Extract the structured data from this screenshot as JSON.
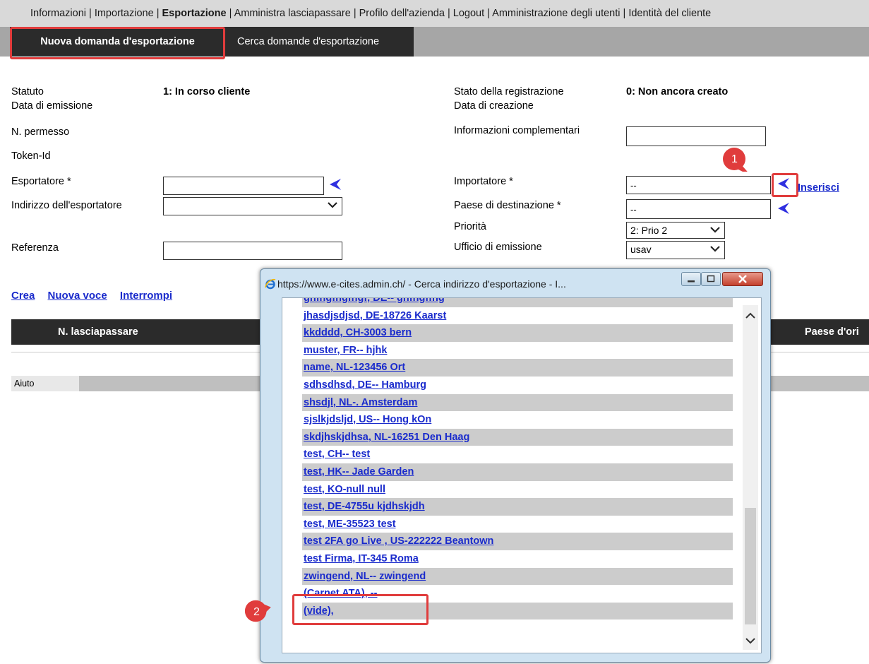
{
  "topnav": {
    "items": [
      "Informazioni",
      "Importazione",
      "Esportazione",
      "Amministra lasciapassare",
      "Profilo dell'azienda",
      "Logout",
      "Amministrazione degli utenti",
      "Identità del cliente"
    ],
    "separator": "|"
  },
  "subnav": {
    "tab_new": "Nuova domanda d'esportazione",
    "tab_search": "Cerca domande d'esportazione"
  },
  "form": {
    "statuto_label": "Statuto",
    "statuto_value": "1: In corso cliente",
    "data_emissione_label": "Data di emissione",
    "stato_registrazione_label": "Stato della registrazione",
    "stato_registrazione_value": "0: Non ancora creato",
    "data_creazione_label": "Data di creazione",
    "permesso_label": "N. permesso",
    "info_compl_label": "Informazioni complementari",
    "token_label": "Token-Id",
    "esportatore_label": "Esportatore *",
    "indirizzo_label": "Indirizzo dell'esportatore",
    "referenza_label": "Referenza",
    "importatore_label": "Importatore *",
    "importatore_value": "--",
    "inserisci_link": "Inserisci",
    "paese_label": "Paese di destinazione *",
    "paese_value": "--",
    "priorita_label": "Priorità",
    "priorita_value": "2: Prio 2",
    "ufficio_label": "Ufficio di emissione",
    "ufficio_value": "usav"
  },
  "actions": {
    "crea": "Crea",
    "nuova_voce": "Nuova voce",
    "interrompi": "Interrompi"
  },
  "table": {
    "col1": "N. lasciapassare",
    "col_last": "Paese d'ori"
  },
  "help": {
    "label": "Aiuto"
  },
  "popup": {
    "title": "https://www.e-cites.admin.ch/ - Cerca indirizzo d'esportazione - I...",
    "items": [
      "ghfhgfhgfhgf, DE-- ghfhgffhg",
      "jhasdjsdjsd, DE-18726 Kaarst",
      "kkdddd, CH-3003 bern",
      "muster, FR-- hjhk",
      "name, NL-123456 Ort",
      "sdhsdhsd, DE-- Hamburg",
      "shsdjl, NL-. Amsterdam",
      "sjslkjdsljd, US-- Hong kOn",
      "skdjhskjdhsa, NL-16251 Den Haag",
      "test, CH-- test",
      "test, HK-- Jade Garden",
      "test, KO-null null",
      "test, DE-4755u kjdhskjdh",
      "test, ME-35523 test",
      "test 2FA go Live , US-222222 Beantown",
      "test Firma, IT-345 Roma",
      "zwingend, NL-- zwingend",
      "(Carnet ATA), --",
      "(vide),"
    ]
  },
  "badges": {
    "step1": "1",
    "step2": "2"
  },
  "colors": {
    "highlight": "#e03c3c",
    "arrow": "#2f2fe0",
    "link": "#1a2bcc",
    "dark_header": "#2b2b2b"
  }
}
